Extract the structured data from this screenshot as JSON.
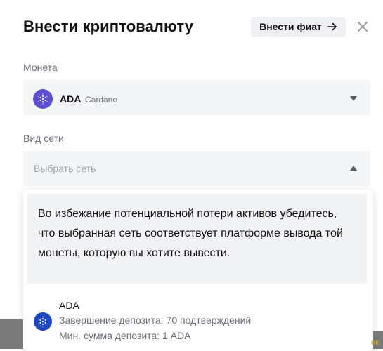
{
  "modal": {
    "title": "Внести криптовалюту",
    "deposit_fiat_label": "Внести фиат"
  },
  "coin": {
    "label": "Монета",
    "ticker": "ADA",
    "name": "Cardano",
    "logo_icon": "cardano-icon",
    "logo_color": "#5a4fcf"
  },
  "network": {
    "label": "Вид сети",
    "placeholder": "Выбрать сеть"
  },
  "dropdown": {
    "warning": "Во избежание потенциальной потери активов убедитесь, что выбранная сеть соответствует платформе вывода той монеты, которую вы хотите вывести.",
    "options": [
      {
        "name": "ADA",
        "completion": "Завершение депозита: 70 подтверждений",
        "min": "Мин. сумма депозита: 1 ADA",
        "logo_icon": "cardano-icon",
        "logo_color": "#1e46c4"
      }
    ]
  },
  "background": {
    "edge_text": "ec"
  }
}
